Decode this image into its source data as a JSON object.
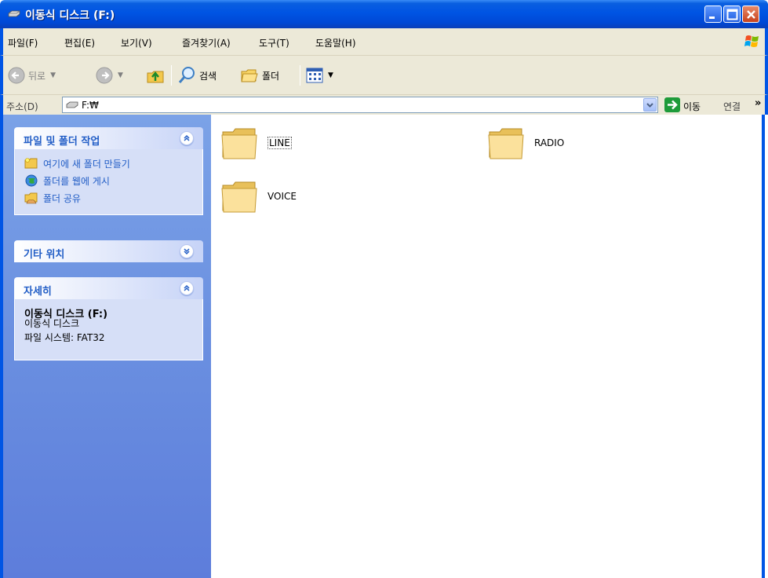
{
  "window": {
    "title": "이동식 디스크 (F:)"
  },
  "menu": [
    "파일(F)",
    "편집(E)",
    "보기(V)",
    "즐겨찾기(A)",
    "도구(T)",
    "도움말(H)"
  ],
  "toolbar": {
    "back": "뒤로",
    "search": "검색",
    "folders": "폴더"
  },
  "address": {
    "label": "주소(D)",
    "value": "F:₩",
    "go": "이동",
    "links": "연결"
  },
  "tasks_panel": {
    "title": "파일 및 폴더 작업",
    "items": [
      "여기에 새 폴더 만들기",
      "폴더를 웹에 게시",
      "폴더 공유"
    ]
  },
  "other_places": {
    "title": "기타 위치"
  },
  "details": {
    "title": "자세히",
    "name": "이동식 디스크 (F:)",
    "type": "이동식 디스크",
    "filesystem": "파일 시스템: FAT32"
  },
  "folders": [
    "LINE",
    "RADIO",
    "VOICE"
  ],
  "colors": {
    "titlebar": "#0054e3",
    "taskpane": "#6a8fe0",
    "link": "#215dc6",
    "chrome": "#ece9d8"
  }
}
